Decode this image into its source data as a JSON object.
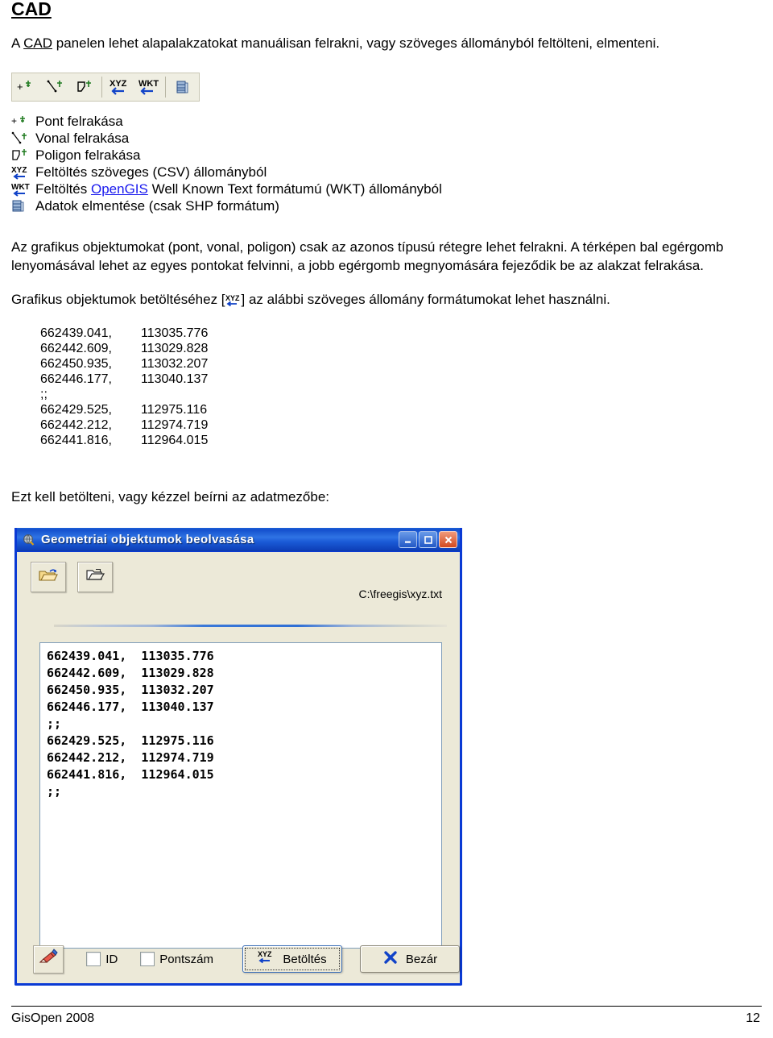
{
  "document": {
    "title": "CAD",
    "intro_before": "A ",
    "intro_link": "CAD",
    "intro_after": " panelen lehet alapalakzatokat manuálisan felrakni, vagy szöveges állományból feltölteni, elmenteni.",
    "paragraph1": "Az grafikus objektumokat (pont, vonal, poligon) csak az azonos típusú rétegre lehet felrakni. A térképen bal egérgomb lenyomásával lehet az egyes pontokat felvinni, a jobb egérgomb megnyomására fejeződik be az alakzat felrakása.",
    "paragraph2_before": "Grafikus objektumok betöltéséhez [",
    "paragraph2_after": "] az alábbi szöveges állomány formátumokat lehet használni.",
    "paragraph3": "Ezt kell betölteni, vagy kézzel beírni az adatmezőbe:"
  },
  "toolbar": {
    "buttons": [
      {
        "name": "point-add-icon",
        "tooltip": "Pont felrakása"
      },
      {
        "name": "line-add-icon",
        "tooltip": "Vonal felrakása"
      },
      {
        "name": "polygon-add-icon",
        "tooltip": "Poligon felrakása"
      },
      {
        "name": "xyz-import-icon",
        "tooltip": "Feltöltés szöveges (CSV) állományból"
      },
      {
        "name": "wkt-import-icon",
        "tooltip": "Feltöltés OpenGIS Well Known Text formátumú (WKT) állományból"
      },
      {
        "name": "database-save-icon",
        "tooltip": "Adatok elmentése (csak SHP formátum)"
      }
    ]
  },
  "legend": [
    {
      "icon": "point-add-icon",
      "label": "Pont felrakása"
    },
    {
      "icon": "line-add-icon",
      "label": "Vonal felrakása"
    },
    {
      "icon": "polygon-add-icon",
      "label": "Poligon felrakása"
    },
    {
      "icon": "xyz-import-icon",
      "label": "Feltöltés szöveges (CSV) állományból"
    },
    {
      "icon": "wkt-import-icon",
      "label_before": "Feltöltés ",
      "link": "OpenGIS",
      "label_after": " Well Known Text formátumú (WKT) állományból"
    },
    {
      "icon": "database-save-icon",
      "label": "Adatok elmentése (csak SHP formátum)"
    }
  ],
  "coordinate_listing": [
    {
      "x": "662439.041,",
      "y": "113035.776"
    },
    {
      "x": "662442.609,",
      "y": "113029.828"
    },
    {
      "x": "662450.935,",
      "y": "113032.207"
    },
    {
      "x": "662446.177,",
      "y": "113040.137"
    },
    {
      "x": ";;",
      "y": ""
    },
    {
      "x": "662429.525,",
      "y": "112975.116"
    },
    {
      "x": "662442.212,",
      "y": "112974.719"
    },
    {
      "x": "662441.816,",
      "y": "112964.015"
    }
  ],
  "dialog": {
    "title": "Geometriai objektumok beolvasása",
    "window_buttons": {
      "minimize": "_",
      "maximize": "□",
      "close": "✕"
    },
    "open_file_button": "open-folder-icon",
    "save_file_button": "save-folder-icon",
    "file_path": "C:\\freegis\\xyz.txt",
    "textarea_value": "662439.041,  113035.776\n662442.609,  113029.828\n662450.935,  113032.207\n662446.177,  113040.137\n;;\n662429.525,  112975.116\n662442.212,  112974.719\n662441.816,  112964.015\n;;",
    "eraser_button": "eraser-icon",
    "checkbox_id_label": "ID",
    "checkbox_id_checked": false,
    "checkbox_points_label": "Pontszám",
    "checkbox_points_checked": false,
    "load_button_label": "Betöltés",
    "load_button_icon": "xyz-import-icon",
    "close_button_label": "Bezár",
    "close_button_icon": "x-blue-icon"
  },
  "footer": {
    "left": "GisOpen 2008",
    "page": "12"
  },
  "colors": {
    "link": "#1a1aee",
    "titlebar": "#1a5ad6",
    "dialog_face": "#ece9d8",
    "accent_blue": "#0a3ad4"
  }
}
